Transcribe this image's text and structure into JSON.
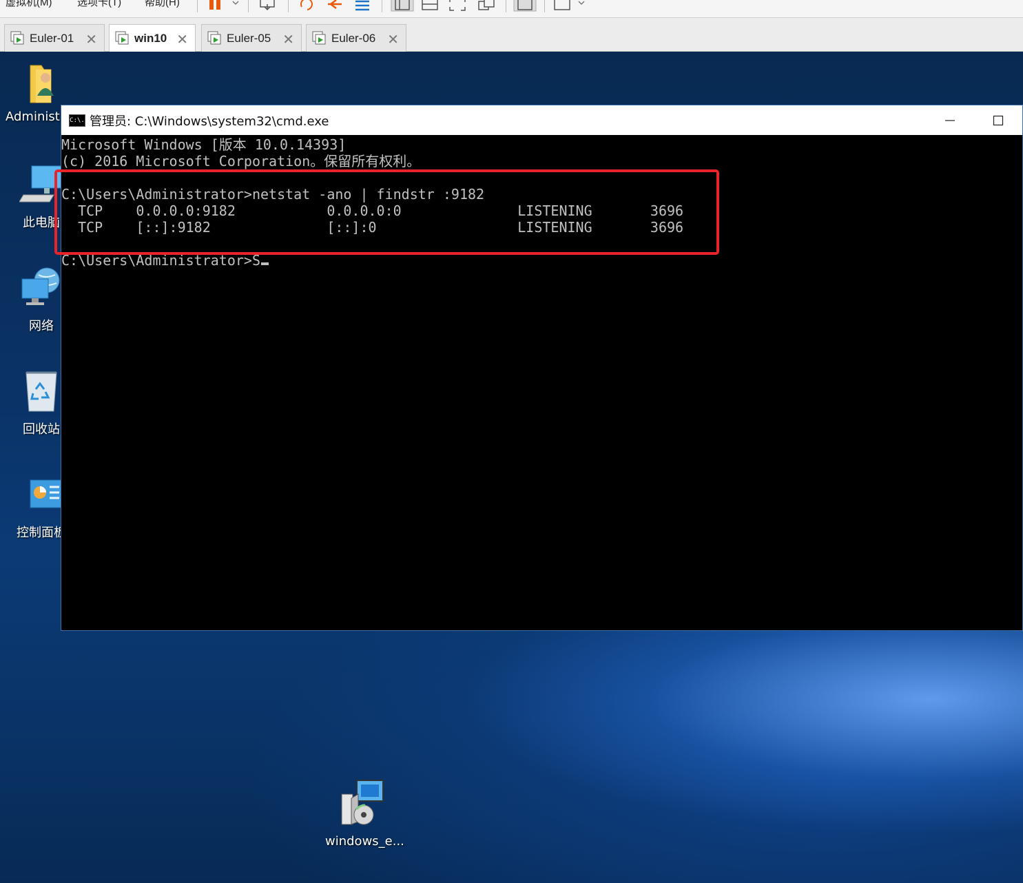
{
  "menubar": {
    "items": [
      "虚拟机(M)",
      "选项卡(T)",
      "帮助(H)"
    ]
  },
  "tabs": [
    {
      "label": "Euler-01",
      "active": false
    },
    {
      "label": "win10",
      "active": true
    },
    {
      "label": "Euler-05",
      "active": false
    },
    {
      "label": "Euler-06",
      "active": false
    }
  ],
  "desktop": {
    "icons": [
      {
        "label": "Administ",
        "icon": "user-folder-icon"
      },
      {
        "label": "此电脑",
        "icon": "this-pc-icon"
      },
      {
        "label": "网络",
        "icon": "network-icon"
      },
      {
        "label": "回收站",
        "icon": "recycle-bin-icon"
      },
      {
        "label": "控制面板",
        "icon": "control-panel-icon"
      },
      {
        "label": "windows_e...",
        "icon": "installer-icon"
      }
    ]
  },
  "cmd": {
    "title": "管理员: C:\\Windows\\system32\\cmd.exe",
    "icon_text": "C:\\.",
    "lines": [
      "Microsoft Windows [版本 10.0.14393]",
      "(c) 2016 Microsoft Corporation。保留所有权利。",
      "",
      "C:\\Users\\Administrator>netstat -ano | findstr :9182",
      "  TCP    0.0.0.0:9182           0.0.0.0:0              LISTENING       3696",
      "  TCP    [::]:9182              [::]:0                 LISTENING       3696",
      "",
      "C:\\Users\\Administrator>S"
    ]
  },
  "colors": {
    "highlight_border": "#e8242a",
    "console_text": "#c0c0c0",
    "console_bg": "#000000"
  }
}
